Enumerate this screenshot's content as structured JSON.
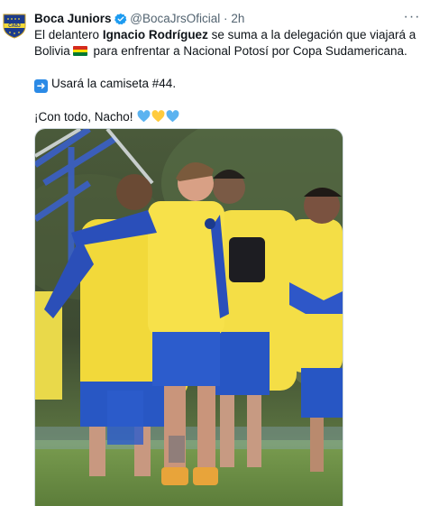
{
  "tweet": {
    "author_name": "Boca Juniors",
    "handle": "@BocaJrsOficial",
    "separator": "·",
    "time": "2h",
    "more_label": "···",
    "avatar_text": "CABJ",
    "line1_prefix": "El delantero ",
    "line1_bold": "Ignacio Rodríguez",
    "line1_suffix": " se suma a la delegación que viajará a",
    "line2_prefix": "Bolivia",
    "line2_suffix": " para enfrentar a Nacional Potosí por Copa Sudamericana.",
    "line3": "Usará la camiseta #44.",
    "line4": "¡Con todo, Nacho!"
  },
  "colors": {
    "boca_blue": "#1c3b8c",
    "boca_yellow": "#f2d93a",
    "verified_blue": "#1d9bf0",
    "heart_blue": "#5bb3f0",
    "heart_yellow": "#ffcb3d"
  },
  "icons": {
    "verified": "verified-badge-icon",
    "more": "more-icon",
    "flag": "bolivia-flag-icon",
    "arrow": "right-arrow-icon",
    "hearts": [
      "blue-heart-icon",
      "yellow-heart-icon",
      "blue-heart-icon"
    ]
  }
}
